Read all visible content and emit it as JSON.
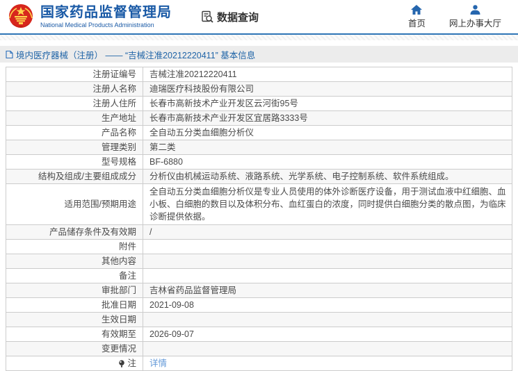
{
  "header": {
    "agency_cn": "国家药品监督管理局",
    "agency_en": "National Medical Products Administration",
    "nav_data_query": "数据查询",
    "nav_home": "首页",
    "nav_service_hall": "网上办事大厅"
  },
  "breadcrumb": {
    "text": "境内医疗器械（注册） —— “吉械注准20212220411” 基本信息"
  },
  "table": {
    "rows": [
      {
        "label": "注册证编号",
        "value": "吉械注准20212220411"
      },
      {
        "label": "注册人名称",
        "value": "迪瑞医疗科技股份有限公司"
      },
      {
        "label": "注册人住所",
        "value": "长春市高新技术产业开发区云河街95号"
      },
      {
        "label": "生产地址",
        "value": "长春市高新技术产业开发区宜居路3333号"
      },
      {
        "label": "产品名称",
        "value": "全自动五分类血细胞分析仪"
      },
      {
        "label": "管理类别",
        "value": "第二类"
      },
      {
        "label": "型号规格",
        "value": "BF-6880"
      },
      {
        "label": "结构及组成/主要组成成分",
        "value": "分析仪由机械运动系统、液路系统、光学系统、电子控制系统、软件系统组成。"
      },
      {
        "label": "适用范围/预期用途",
        "value": "全自动五分类血细胞分析仪是专业人员使用的体外诊断医疗设备，用于测试血液中红细胞、血小板、白细胞的数目以及体积分布、血红蛋白的浓度，同时提供白细胞分类的散点图，为临床诊断提供依据。",
        "tall": true
      },
      {
        "label": "产品储存条件及有效期",
        "value": "/"
      },
      {
        "label": "附件",
        "value": ""
      },
      {
        "label": "其他内容",
        "value": ""
      },
      {
        "label": "备注",
        "value": ""
      },
      {
        "label": "审批部门",
        "value": "吉林省药品监督管理局"
      },
      {
        "label": "批准日期",
        "value": "2021-09-08"
      },
      {
        "label": "生效日期",
        "value": ""
      },
      {
        "label": "有效期至",
        "value": "2026-09-07"
      },
      {
        "label": "变更情况",
        "value": ""
      },
      {
        "label": "注",
        "value": "详情",
        "link": true,
        "icon": "note-bulb-icon"
      }
    ]
  },
  "colors": {
    "accent_blue": "#1a5aa6",
    "header_border_blue": "#2e75b6",
    "icon_blue": "#2566ae",
    "breadcrumb_text": "#1f64a7",
    "breadcrumb_bg": "#ececec",
    "link_blue": "#6399d8",
    "table_border": "#cccccc",
    "row_stripe": "#f7f7f7",
    "text_dark": "#4a4a4a",
    "emblem_red": "#d7261d",
    "emblem_gold": "#ffd34d"
  }
}
